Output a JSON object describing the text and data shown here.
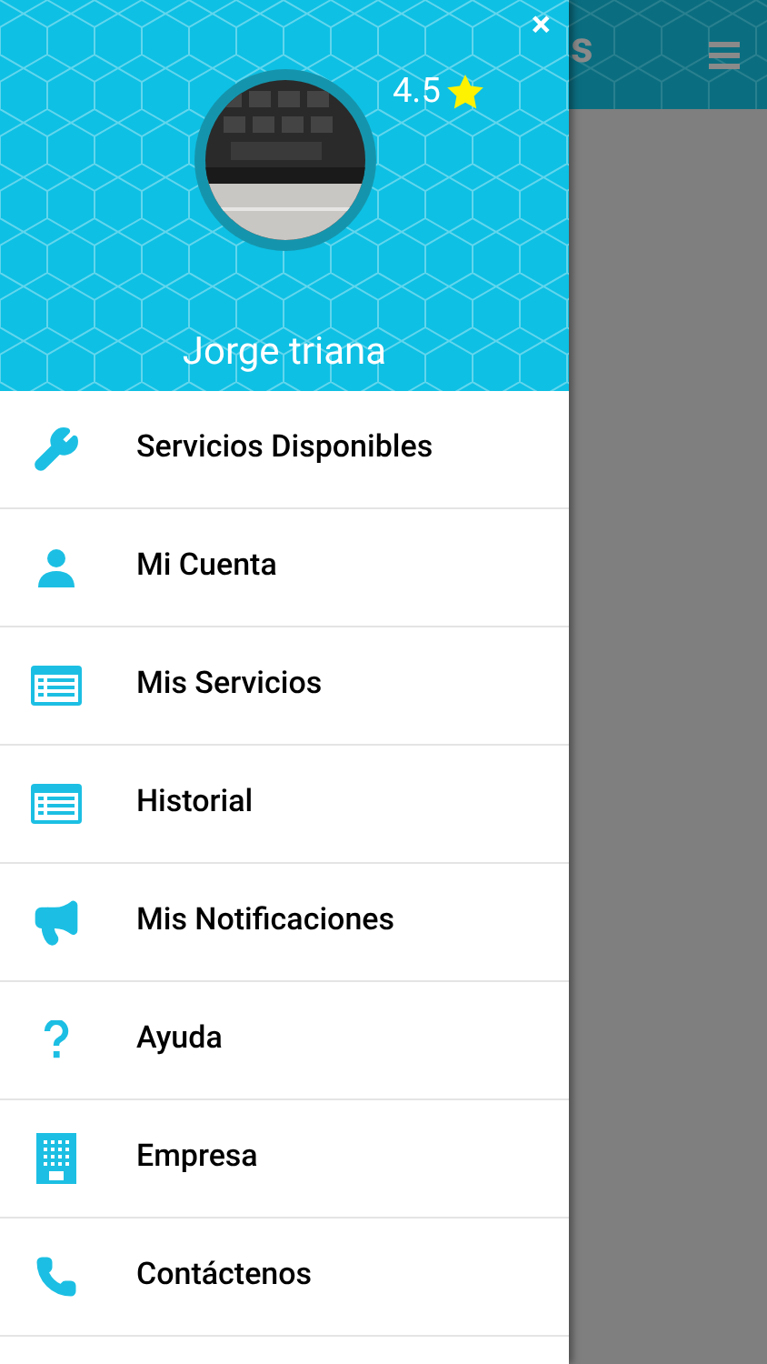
{
  "app_bar": {
    "title_fragment": "s"
  },
  "drawer": {
    "close": "×",
    "rating": "4.5",
    "user_name": "Jorge triana",
    "items": [
      {
        "label": "Servicios Disponibles",
        "kind": "wrench"
      },
      {
        "label": "Mi Cuenta",
        "kind": "user"
      },
      {
        "label": "Mis Servicios",
        "kind": "list"
      },
      {
        "label": "Historial",
        "kind": "list"
      },
      {
        "label": "Mis Notificaciones",
        "kind": "megaphone"
      },
      {
        "label": "Ayuda",
        "kind": "help"
      },
      {
        "label": "Empresa",
        "kind": "building"
      },
      {
        "label": "Contáctenos",
        "kind": "phone"
      }
    ]
  }
}
